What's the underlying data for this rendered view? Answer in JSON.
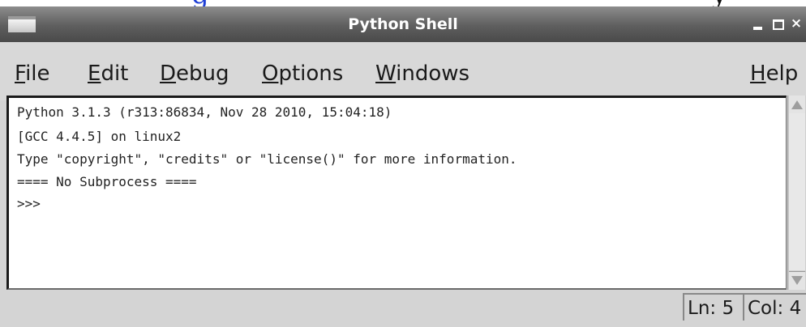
{
  "page_header": {
    "link_fragment": "g",
    "text_fragment": "y"
  },
  "window": {
    "title": "Python Shell",
    "minimize_label": "_",
    "close_label": "×"
  },
  "menu": {
    "file": {
      "mnemonic": "F",
      "rest": "ile"
    },
    "edit": {
      "mnemonic": "E",
      "rest": "dit"
    },
    "debug": {
      "mnemonic": "D",
      "rest": "ebug"
    },
    "options": {
      "mnemonic": "O",
      "rest": "ptions"
    },
    "windows": {
      "mnemonic": "W",
      "rest": "indows"
    },
    "help": {
      "mnemonic": "H",
      "rest": "elp"
    }
  },
  "shell": {
    "lines": [
      "Python 3.1.3 (r313:86834, Nov 28 2010, 15:04:18)",
      "[GCC 4.4.5] on linux2",
      "Type \"copyright\", \"credits\" or \"license()\" for more information.",
      "==== No Subprocess ====",
      ">>>"
    ]
  },
  "status": {
    "line": "Ln: 5",
    "column": "Col: 4"
  },
  "colors": {
    "link": "#1f3fd6",
    "titlebar": "#5e5e5e",
    "menubar": "#d8d8d8",
    "editor_background": "#ffffff"
  }
}
